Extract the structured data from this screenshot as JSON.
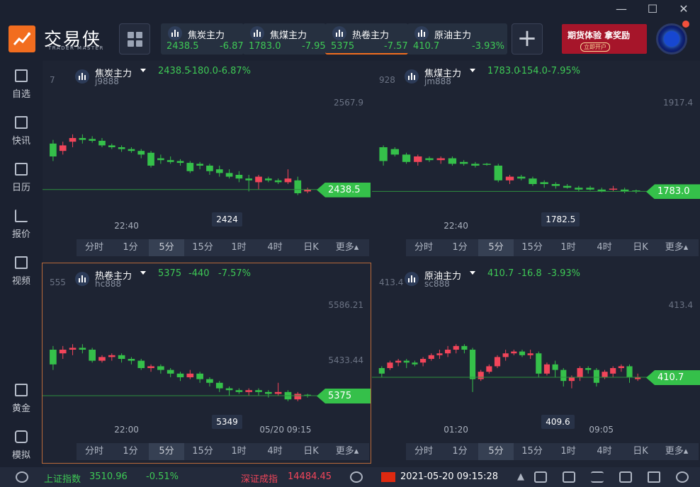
{
  "app": {
    "name": "交易侠",
    "subtitle": "TRADER MASTER"
  },
  "window_controls": {
    "close": "✕",
    "minimize": "—",
    "maximize": "☐"
  },
  "top_tabs": [
    {
      "name": "焦炭主力",
      "price": "2438.5",
      "change": "-6.87%"
    },
    {
      "name": "焦煤主力",
      "price": "1783.0",
      "change": "-7.95%"
    },
    {
      "name": "热卷主力",
      "price": "5375",
      "change": "-7.57%"
    },
    {
      "name": "原油主力",
      "price": "410.7",
      "change": "-3.93%"
    }
  ],
  "add_tab_label": "+",
  "banner": {
    "title": "期货体验  拿奖励",
    "cta": "立即开户"
  },
  "sidebar": [
    {
      "label": "自选",
      "icon": "bookmark-icon"
    },
    {
      "label": "快讯",
      "icon": "news-icon"
    },
    {
      "label": "日历",
      "icon": "calendar-icon"
    },
    {
      "label": "报价",
      "icon": "chart-line-icon"
    },
    {
      "label": "视频",
      "icon": "play-icon"
    },
    {
      "label": "黄金",
      "icon": "gold-icon"
    },
    {
      "label": "模拟",
      "icon": "wallet-icon"
    }
  ],
  "periods": [
    "分时",
    "1分",
    "5分",
    "15分",
    "1时",
    "4时",
    "日K",
    "更多"
  ],
  "active_period": "5分",
  "panels": [
    {
      "name": "焦炭主力",
      "code": "j9888",
      "price": "2438.5",
      "change": "-180.0",
      "pct": "-6.87%",
      "axis_top": "2567.9",
      "left_label": "7",
      "cross_price": "2424",
      "time_labels": [
        "22:40"
      ],
      "last_price_tag": "2438.5",
      "active": false
    },
    {
      "name": "焦煤主力",
      "code": "jm888",
      "price": "1783.0",
      "change": "-154.0",
      "pct": "-7.95%",
      "axis_top": "1917.4",
      "left_label": "928",
      "cross_price": "1782.5",
      "time_labels": [
        "22:40"
      ],
      "last_price_tag": "1783.0",
      "active": false
    },
    {
      "name": "热卷主力",
      "code": "hc888",
      "price": "5375",
      "change": "-440",
      "pct": "-7.57%",
      "axis_top": "5586.21",
      "axis_mid": "5433.44",
      "left_label": "555",
      "cross_price": "5349",
      "time_labels": [
        "22:00",
        "05/20 09:15"
      ],
      "last_price_tag": "5375",
      "active": true
    },
    {
      "name": "原油主力",
      "code": "sc888",
      "price": "410.7",
      "change": "-16.8",
      "pct": "-3.93%",
      "axis_top": "413.4",
      "left_label": "413.4",
      "cross_price": "409.6",
      "time_labels": [
        "01:20",
        "09:05"
      ],
      "last_price_tag": "410.7",
      "active": false
    }
  ],
  "status": {
    "idx1_name": "上证指数",
    "idx1_value": "3510.96",
    "idx1_pct": "-0.51%",
    "idx2_name": "深证成指",
    "idx2_value": "14484.45",
    "datetime": "2021-05-20 09:15:28"
  },
  "colors": {
    "up": "#f2455a",
    "down": "#35c04a",
    "accent": "#f26d1f"
  }
}
